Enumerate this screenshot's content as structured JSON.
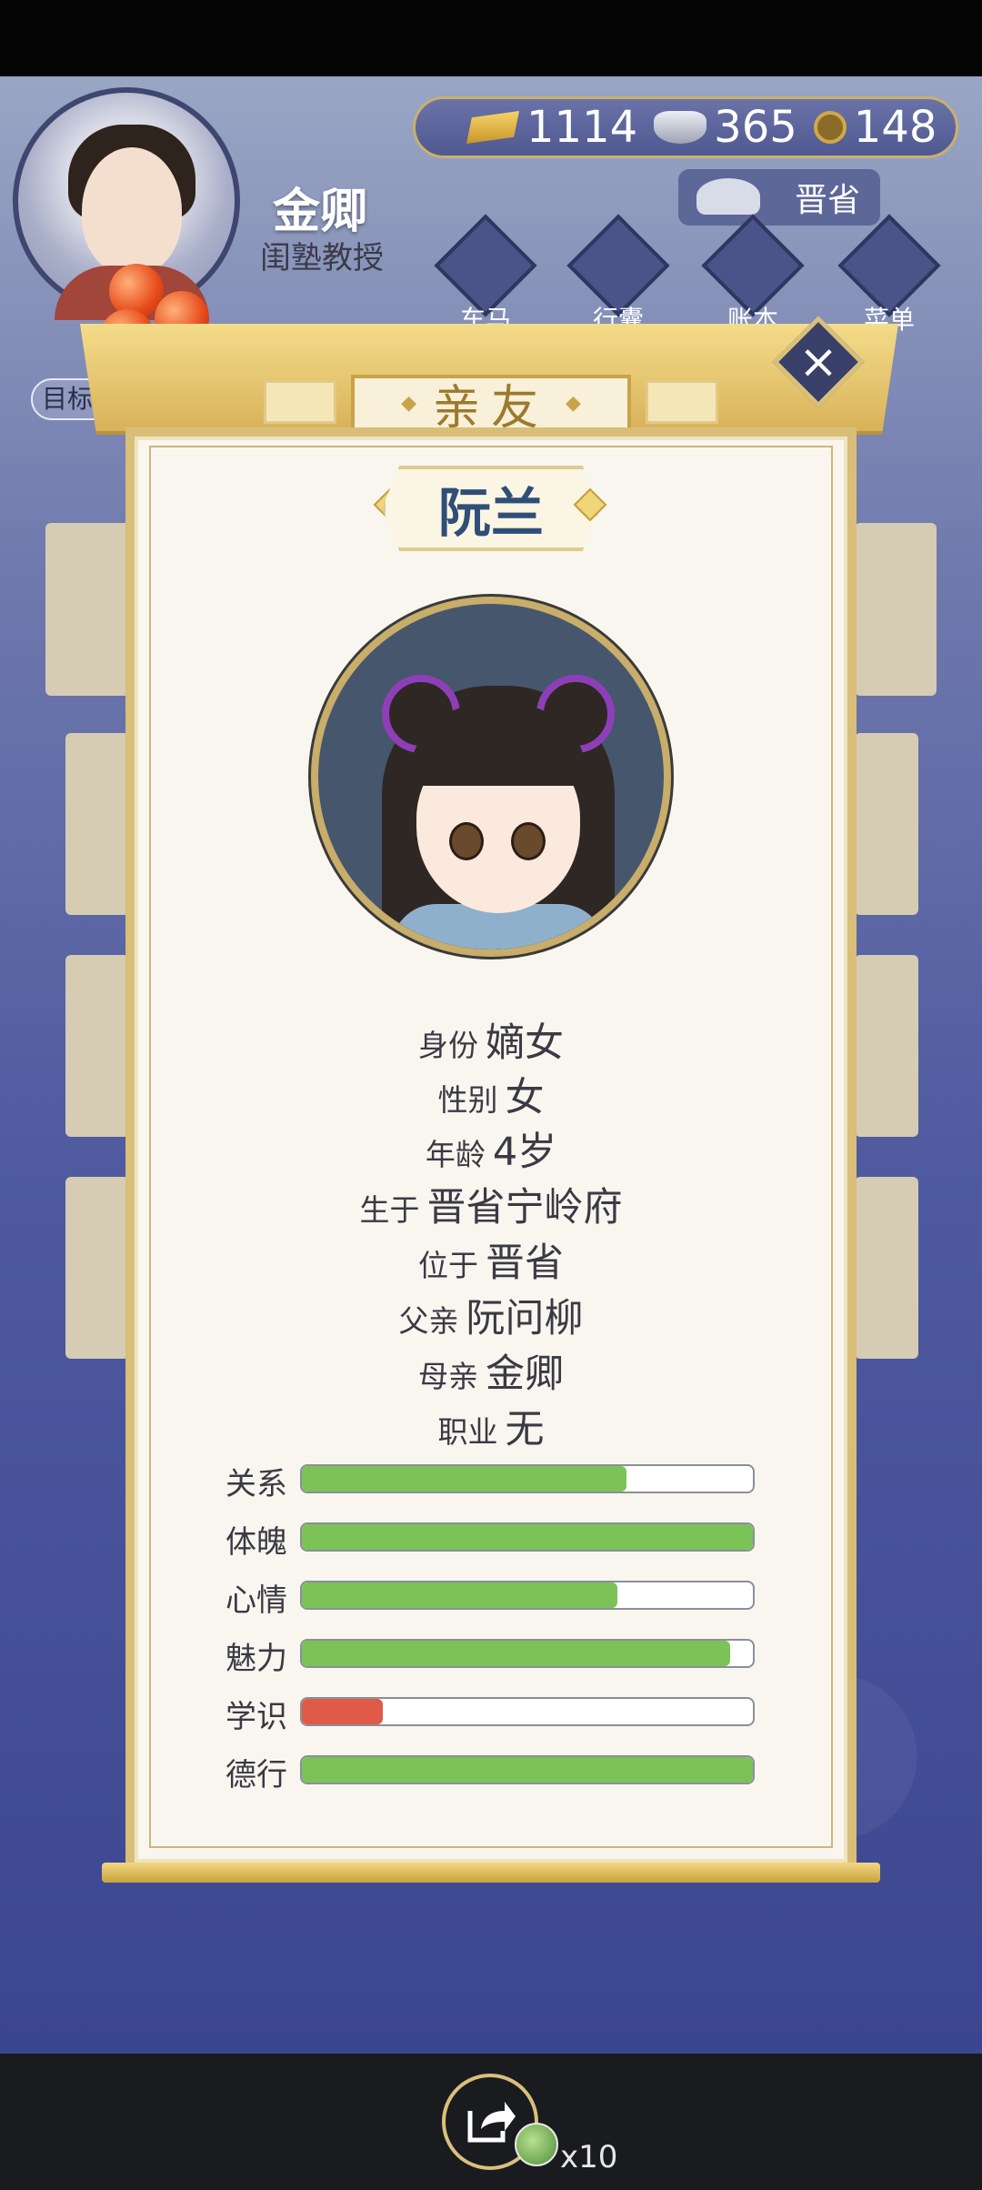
{
  "player": {
    "name": "金卿",
    "title": "闺塾教授"
  },
  "currency": {
    "gold": "1114",
    "silver": "365",
    "coins": "148"
  },
  "region": "晋省",
  "menu": [
    {
      "label": "车马"
    },
    {
      "label": "行囊"
    },
    {
      "label": "账本"
    },
    {
      "label": "菜单"
    }
  ],
  "target_label": "目标",
  "modal": {
    "title": "亲友",
    "character_name": "阮兰",
    "info": [
      {
        "label": "身份",
        "value": "嫡女"
      },
      {
        "label": "性别",
        "value": "女"
      },
      {
        "label": "年龄",
        "value": "4岁"
      },
      {
        "label": "生于",
        "value": "晋省宁岭府"
      },
      {
        "label": "位于",
        "value": "晋省"
      },
      {
        "label": "父亲",
        "value": "阮问柳"
      },
      {
        "label": "母亲",
        "value": "金卿"
      },
      {
        "label": "职业",
        "value": "无"
      }
    ],
    "stats": [
      {
        "label": "关系",
        "fraction": 0.72,
        "color": "#7bc257"
      },
      {
        "label": "体魄",
        "fraction": 1.0,
        "color": "#7bc257"
      },
      {
        "label": "心情",
        "fraction": 0.7,
        "color": "#7bc257"
      },
      {
        "label": "魅力",
        "fraction": 0.95,
        "color": "#7bc257"
      },
      {
        "label": "学识",
        "fraction": 0.18,
        "color": "#e05a48"
      },
      {
        "label": "德行",
        "fraction": 1.0,
        "color": "#7bc257"
      }
    ]
  },
  "share": {
    "count": "x10"
  },
  "icons": {
    "close": "close-icon",
    "share": "share-icon"
  }
}
